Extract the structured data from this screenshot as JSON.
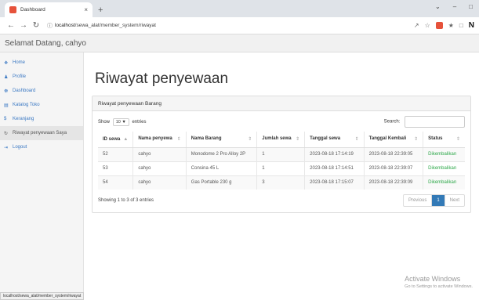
{
  "browser": {
    "tab_title": "Dashboard",
    "tab_close": "×",
    "new_tab": "+",
    "url_host": "localhost",
    "url_path": "/sewa_alat/member_system/riwayat",
    "status_url": "localhost/sewa_alat/member_system/riwayat"
  },
  "header": {
    "welcome": "Selamat Datang, cahyo"
  },
  "sidebar": {
    "items": [
      {
        "icon": "home-icon",
        "glyph": "❖",
        "label": "Home"
      },
      {
        "icon": "user-icon",
        "glyph": "♟",
        "label": "Profile"
      },
      {
        "icon": "dashboard-icon",
        "glyph": "☸",
        "label": "Dashboard"
      },
      {
        "icon": "list-icon",
        "glyph": "▤",
        "label": "Katalog Toko"
      },
      {
        "icon": "dollar-icon",
        "glyph": "$",
        "label": "Keranjang"
      },
      {
        "icon": "history-icon",
        "glyph": "↻",
        "label": "Riwayat penyewaan Saya"
      },
      {
        "icon": "logout-icon",
        "glyph": "⇥",
        "label": "Logout"
      }
    ]
  },
  "main": {
    "title": "Riwayat penyewaan",
    "panel_title": "Riwayat penyewaan Barang",
    "show_label": "Show",
    "entries_value": "10",
    "entries_label": "entries",
    "search_label": "Search:",
    "table": {
      "columns": [
        "ID sewa",
        "Nama penyewa",
        "Nama Barang",
        "Jumlah sewa",
        "Tanggal sewa",
        "Tanggal Kembali",
        "Status"
      ],
      "sort_glyphs": [
        "▲",
        "⇕",
        "⇕",
        "⇕",
        "⇕",
        "⇕",
        "⇕"
      ],
      "rows": [
        [
          "52",
          "cahyo",
          "Monodome 2 Pro Alloy 2P",
          "1",
          "2023-08-18 17:14:19",
          "2023-08-18 22:39:05",
          "Dikembalikan"
        ],
        [
          "53",
          "cahyo",
          "Consina 45 L",
          "1",
          "2023-08-18 17:14:51",
          "2023-08-18 22:39:07",
          "Dikembalikan"
        ],
        [
          "54",
          "cahyo",
          "Gas Portable 230 g",
          "3",
          "2023-08-18 17:15:07",
          "2023-08-18 22:39:09",
          "Dikembalikan"
        ]
      ]
    },
    "info": "Showing 1 to 3 of 3 entries",
    "pagination": {
      "previous": "Previous",
      "current": "1",
      "next": "Next"
    }
  },
  "watermark": {
    "line1": "Activate Windows",
    "line2": "Go to Settings to activate Windows."
  }
}
